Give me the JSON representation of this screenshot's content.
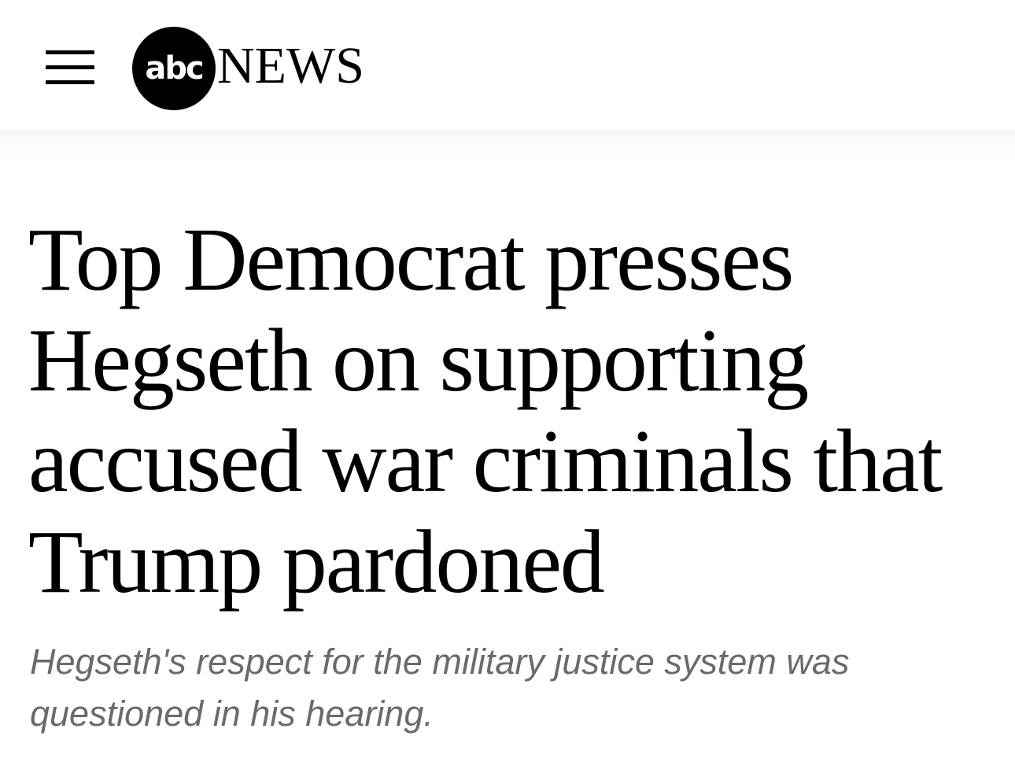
{
  "header": {
    "logo": {
      "mark_text": "abc",
      "wordmark": "NEWS"
    },
    "menu_icon": "hamburger-menu-icon"
  },
  "article": {
    "headline": "Top Democrat presses Hegseth on supporting accused war criminals that Trump pardoned",
    "subheadline": "Hegseth's respect for the military justice system was questioned in his hearing."
  },
  "colors": {
    "background": "#ffffff",
    "text": "#000000",
    "subheadline": "#6a6a6a"
  }
}
